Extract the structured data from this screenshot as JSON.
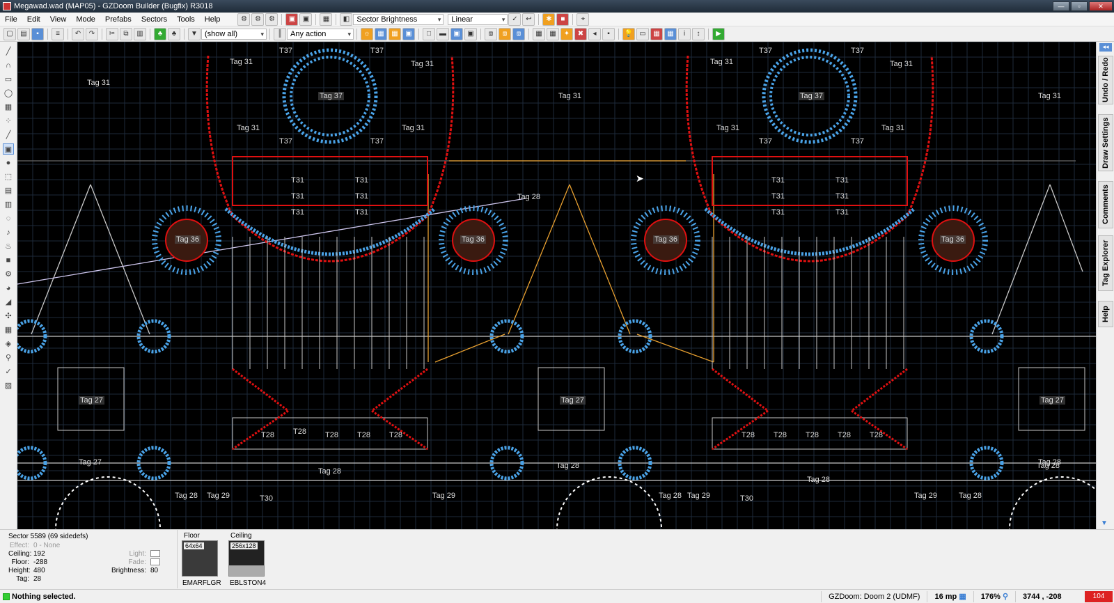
{
  "window": {
    "title": "Megawad.wad (MAP05) - GZDoom Builder (Bugfix) R3018",
    "version_badge": "R3018"
  },
  "menu": [
    "File",
    "Edit",
    "View",
    "Mode",
    "Prefabs",
    "Sectors",
    "Tools",
    "Help"
  ],
  "toolbar": {
    "view_mode_combo": "Sector Brightness",
    "interpolation_combo": "Linear",
    "filter_combo": "(show all)",
    "action_combo": "Any action"
  },
  "map": {
    "tags": [
      "Tag 31",
      "Tag 31",
      "Tag 31",
      "Tag 31",
      "Tag 31",
      "Tag 31",
      "Tag 31",
      "Tag 31",
      "Tag 31",
      "Tag 31",
      "Tag 31",
      "T37",
      "T37",
      "T37",
      "T37",
      "T37",
      "T37",
      "T37",
      "T37",
      "Tag 37",
      "Tag 37",
      "T31",
      "T31",
      "T31",
      "T31",
      "T31",
      "T31",
      "T31",
      "T31",
      "T31",
      "T31",
      "T31",
      "T31",
      "Tag 28",
      "Tag 36",
      "Tag 36",
      "Tag 36",
      "Tag 36",
      "Tag 27",
      "Tag 27",
      "Tag 27",
      "Tag 27",
      "T28",
      "T28",
      "T28",
      "T28",
      "T28",
      "T28",
      "T28",
      "T28",
      "T28",
      "T28",
      "Tag 28",
      "Tag 28",
      "Tag 28",
      "Tag 28",
      "Tag 28",
      "Tag 28",
      "Tag 28",
      "Tag 28",
      "Tag 29",
      "Tag 29",
      "Tag 29",
      "Tag 29",
      "T30",
      "T30"
    ]
  },
  "dock_tabs": [
    "Undo / Redo",
    "Draw Settings",
    "Comments",
    "Tag Explorer",
    "Help"
  ],
  "sector_info": {
    "title": "Sector 5589 (69 sidedefs)",
    "effect_label": "Effect:",
    "effect_value": "0 - None",
    "ceiling_label": "Ceiling:",
    "ceiling_value": "192",
    "floor_label": "Floor:",
    "floor_value": "-288",
    "height_label": "Height:",
    "height_value": "480",
    "tag_label": "Tag:",
    "tag_value": "28",
    "light_label": "Light:",
    "fade_label": "Fade:",
    "brightness_label": "Brightness:",
    "brightness_value": "80",
    "floor_tex_title": "Floor",
    "floor_tex_size": "64x64",
    "floor_tex_name": "EMARFLGR",
    "ceiling_tex_title": "Ceiling",
    "ceiling_tex_size": "256x128",
    "ceiling_tex_name": "EBLSTON4"
  },
  "status": {
    "message": "Nothing selected.",
    "game_config": "GZDoom: Doom 2 (UDMF)",
    "grid": "16 mp",
    "zoom": "176%",
    "coords": "3744 , -208",
    "warnings": "104"
  },
  "colors": {
    "map_bg": "#000000",
    "linedef": "#c8c8c8",
    "vertex_blue": "#4aa3e8",
    "twosided_red": "#e01010",
    "highlight_orange": "#e8a030",
    "grid": "#1e2a3a"
  }
}
